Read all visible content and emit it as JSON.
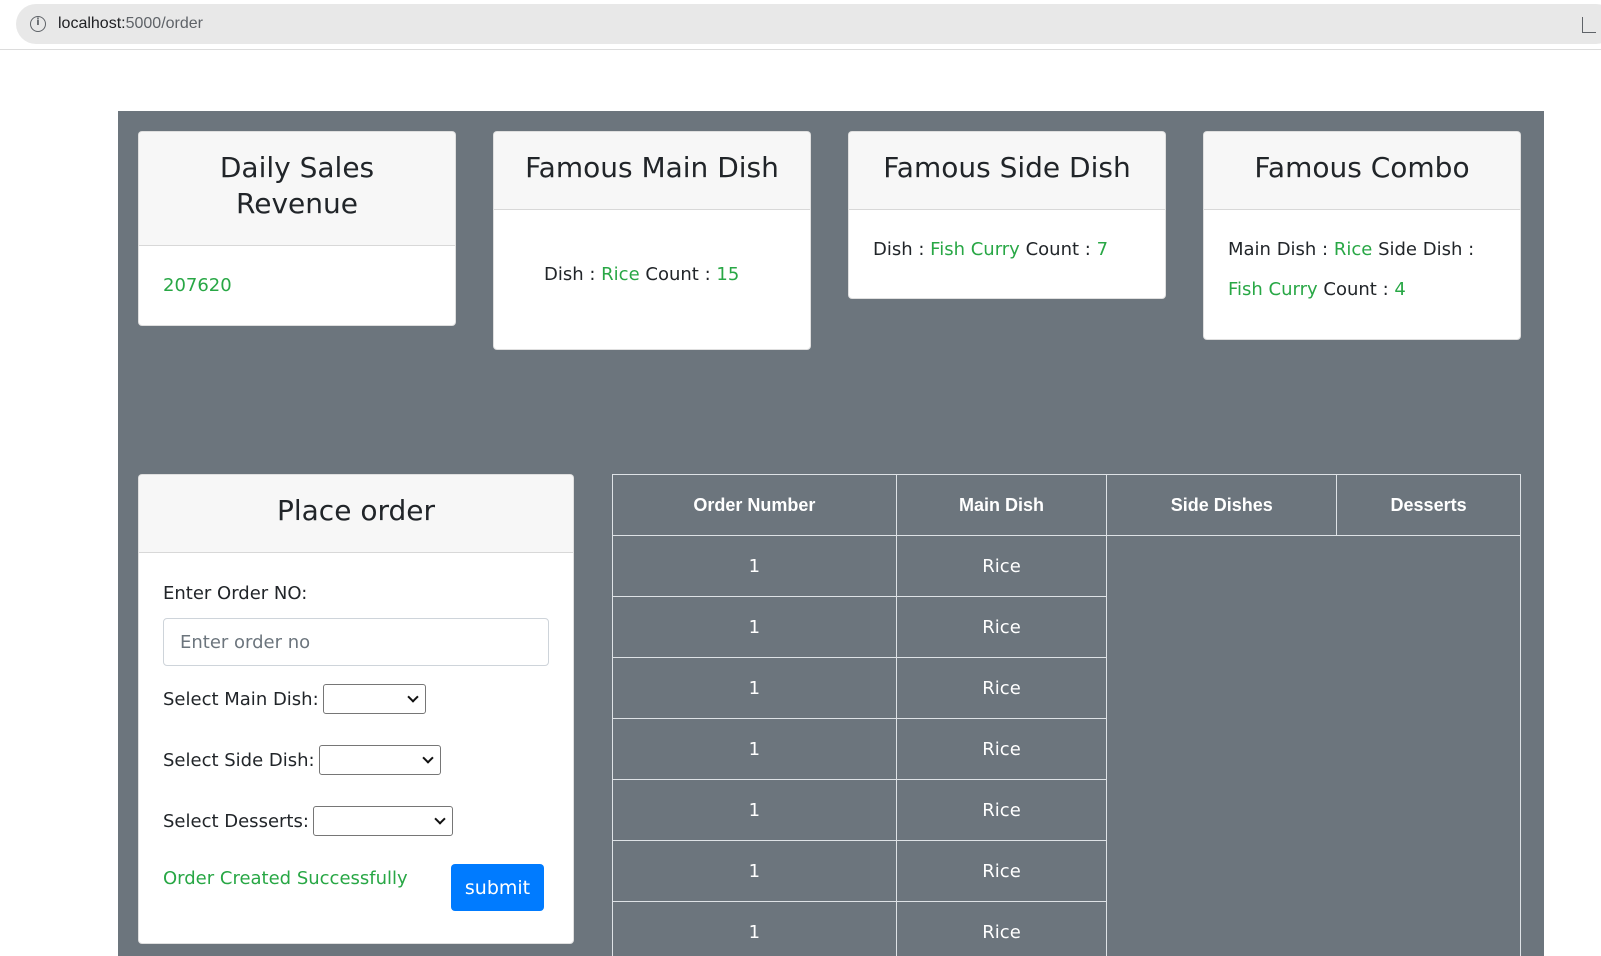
{
  "browser": {
    "url_host": "localhost:",
    "url_path": "5000/order"
  },
  "cards": {
    "sales": {
      "title": "Daily Sales Revenue",
      "value": "207620"
    },
    "main_dish": {
      "title": "Famous Main Dish",
      "dish_label": "Dish :",
      "dish": "Rice",
      "count_label": "Count :",
      "count": "15"
    },
    "side_dish": {
      "title": "Famous Side Dish",
      "dish_label": "Dish :",
      "dish": "Fish Curry",
      "count_label": "Count :",
      "count": "7"
    },
    "combo": {
      "title": "Famous Combo",
      "main_label": "Main Dish :",
      "main": "Rice",
      "side_label": "Side Dish :",
      "side": "Fish Curry",
      "count_label": "Count :",
      "count": "4"
    }
  },
  "form": {
    "title": "Place order",
    "order_label": "Enter Order NO:",
    "order_placeholder": "Enter order no",
    "order_value": "",
    "main_label": "Select Main Dish:",
    "side_label": "Select Side Dish:",
    "dessert_label": "Select Desserts:",
    "success_message": "Order Created Successfully",
    "submit_label": "submit"
  },
  "table": {
    "headers": [
      "Order Number",
      "Main Dish",
      "Side Dishes",
      "Desserts"
    ],
    "rows": [
      {
        "order_number": "1",
        "main_dish": "Rice"
      },
      {
        "order_number": "1",
        "main_dish": "Rice"
      },
      {
        "order_number": "1",
        "main_dish": "Rice"
      },
      {
        "order_number": "1",
        "main_dish": "Rice"
      },
      {
        "order_number": "1",
        "main_dish": "Rice"
      },
      {
        "order_number": "1",
        "main_dish": "Rice"
      },
      {
        "order_number": "1",
        "main_dish": "Rice"
      }
    ]
  },
  "colors": {
    "panel_bg": "#6c757d",
    "accent_green": "#28a745",
    "button_blue": "#007bff"
  },
  "icons": {
    "site_info": "info-icon",
    "share": "share-icon"
  }
}
